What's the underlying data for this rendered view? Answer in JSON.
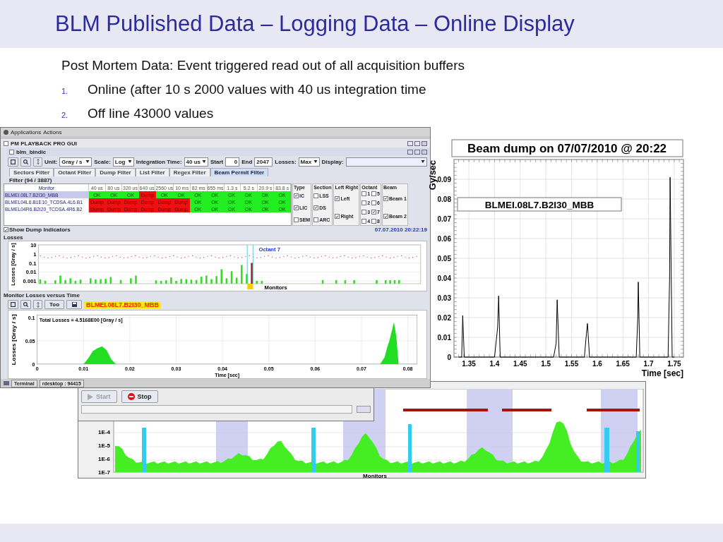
{
  "slide": {
    "title": "BLM Published Data – Logging Data – Online Display",
    "intro": "Post Mortem Data: Event triggered read out of all acquisition buffers",
    "items": [
      {
        "number": "1.",
        "text": "Online (after 10 s 2000 values with 40 us integration time"
      },
      {
        "number": "2.",
        "text": "Off line 43000 values"
      }
    ]
  },
  "gui": {
    "desktop_menu": [
      "Applications",
      "Actions"
    ],
    "window_title": "PM PLAYBACK PRO GUI",
    "frame_title": "blm_bindic",
    "toolbar": {
      "unit_label": "Unit:",
      "unit": "Gray / s",
      "scale_label": "Scale:",
      "scale": "Log",
      "integration_label": "Integration Time:",
      "integration": "40 us",
      "start_label": "Start",
      "start": "0",
      "end_label": "End",
      "end": "2047",
      "losses_label": "Losses:",
      "losses": "Max",
      "display_label": "Display:"
    },
    "tabs": [
      {
        "label": "Sectors Filter",
        "selected": false
      },
      {
        "label": "Octant Filter",
        "selected": false
      },
      {
        "label": "Dump Filter",
        "selected": false
      },
      {
        "label": "List Filter",
        "selected": false
      },
      {
        "label": "Regex Filter",
        "selected": false
      },
      {
        "label": "Beam Permit Filter",
        "selected": true
      }
    ],
    "filter_count": "Filter (94 / 3887)",
    "table": {
      "columns": [
        "Monitor",
        "40 us",
        "80 us",
        "320 us",
        "640 us",
        "2560 us",
        "10 ms",
        "82 ms",
        "655 ms",
        "1.3 s",
        "5.2 s",
        "20.9 s",
        "83.8 s"
      ],
      "rows": [
        {
          "selected": true,
          "cells": [
            {
              "kind": "monitor",
              "text": "BLMEI.08L7.B2I30_MBB"
            },
            {
              "kind": "ok",
              "text": "OK"
            },
            {
              "kind": "ok",
              "text": "OK"
            },
            {
              "kind": "ok",
              "text": "OK"
            },
            {
              "kind": "dump",
              "text": "Dump"
            },
            {
              "kind": "ok",
              "text": "OK"
            },
            {
              "kind": "ok",
              "text": "OK"
            },
            {
              "kind": "ok",
              "text": "OK"
            },
            {
              "kind": "ok",
              "text": "OK"
            },
            {
              "kind": "ok",
              "text": "OK"
            },
            {
              "kind": "ok",
              "text": "OK"
            },
            {
              "kind": "ok",
              "text": "OK"
            },
            {
              "kind": "ok",
              "text": "OK"
            }
          ]
        },
        {
          "selected": false,
          "cells": [
            {
              "kind": "monitor",
              "text": "BLMEL04L6.B1E10_TCDSA.4L6.B1"
            },
            {
              "kind": "dump",
              "text": "Dump"
            },
            {
              "kind": "dump",
              "text": "Dump"
            },
            {
              "kind": "dump",
              "text": "Dump"
            },
            {
              "kind": "dump",
              "text": "Dump"
            },
            {
              "kind": "dump",
              "text": "Dump"
            },
            {
              "kind": "dump",
              "text": "Dump"
            },
            {
              "kind": "ok",
              "text": "OK"
            },
            {
              "kind": "ok",
              "text": "OK"
            },
            {
              "kind": "ok",
              "text": "OK"
            },
            {
              "kind": "ok",
              "text": "OK"
            },
            {
              "kind": "ok",
              "text": "OK"
            },
            {
              "kind": "ok",
              "text": "OK"
            }
          ]
        },
        {
          "selected": false,
          "cells": [
            {
              "kind": "monitor",
              "text": "BLMEL04R6.B2I20_TCDSA.4R6.B2"
            },
            {
              "kind": "dump",
              "text": "Dump"
            },
            {
              "kind": "dump",
              "text": "Dump"
            },
            {
              "kind": "dump",
              "text": "Dump"
            },
            {
              "kind": "dump",
              "text": "Dump"
            },
            {
              "kind": "dump",
              "text": "Dump"
            },
            {
              "kind": "dump",
              "text": "Dump"
            },
            {
              "kind": "ok",
              "text": "OK"
            },
            {
              "kind": "ok",
              "text": "OK"
            },
            {
              "kind": "ok",
              "text": "OK"
            },
            {
              "kind": "ok",
              "text": "OK"
            },
            {
              "kind": "ok",
              "text": "OK"
            },
            {
              "kind": "ok",
              "text": "OK"
            }
          ]
        }
      ]
    },
    "filters": [
      {
        "title": "Type",
        "options": [
          {
            "label": "IC",
            "checked": true
          },
          {
            "label": "LIC",
            "checked": true
          },
          {
            "label": "SEM",
            "checked": false
          }
        ]
      },
      {
        "title": "Section",
        "options": [
          {
            "label": "LSS",
            "checked": false
          },
          {
            "label": "DS",
            "checked": true
          },
          {
            "label": "ARC",
            "checked": false
          }
        ]
      },
      {
        "title": "Left Right",
        "options": [
          {
            "label": "Left",
            "checked": true
          },
          {
            "label": "Right",
            "checked": true
          }
        ]
      },
      {
        "title": "Octant",
        "options": [
          {
            "label": "1",
            "checked": false
          },
          {
            "label": "5",
            "checked": false
          },
          {
            "label": "2",
            "checked": false
          },
          {
            "label": "6",
            "checked": false
          },
          {
            "label": "3",
            "checked": false
          },
          {
            "label": "7",
            "checked": true
          },
          {
            "label": "4",
            "checked": false
          },
          {
            "label": "8",
            "checked": false
          }
        ]
      },
      {
        "title": "Beam",
        "options": [
          {
            "label": "Beam 1",
            "checked": true
          },
          {
            "label": "Beam 2",
            "checked": true
          }
        ]
      }
    ],
    "show_dump": {
      "label": "Show Dump Indicators",
      "checked": true
    },
    "timestamp": "07.07.2010 20:22:19",
    "losses_panel": {
      "title": "Losses",
      "ylabel": "Losses [Gray / s]",
      "yticks": [
        "10",
        "1",
        "0.1",
        "0.01",
        "0.001"
      ],
      "xlabel": "Monitors",
      "marker": "Octant 7"
    },
    "time_panel": {
      "title": "Monitor Losses versus Time",
      "too_button": "Too",
      "monitor": "BLMEI.08L7.B2I30_MBB",
      "chart_data": {
        "type": "area",
        "grid": true,
        "ylabel": "Losses [Gray / s]",
        "xlabel": "Time [sec]",
        "annotations": [
          "Total Losses = 4.5168E00 [Gray / s]"
        ],
        "xlim": [
          0,
          0.082
        ],
        "ylim": [
          0,
          0.105
        ],
        "xticks": [
          {
            "value": 0,
            "label": "0"
          },
          {
            "value": 0.01,
            "label": "0.01"
          },
          {
            "value": 0.02,
            "label": "0.02"
          },
          {
            "value": 0.03,
            "label": "0.03"
          },
          {
            "value": 0.04,
            "label": "0.04"
          },
          {
            "value": 0.05,
            "label": "0.05"
          },
          {
            "value": 0.06,
            "label": "0.06"
          },
          {
            "value": 0.07,
            "label": "0.07"
          },
          {
            "value": 0.08,
            "label": "0.08"
          }
        ],
        "yticks": [
          {
            "value": 0,
            "label": "0"
          },
          {
            "value": 0.05,
            "label": "0.05"
          },
          {
            "value": 0.1,
            "label": "0.1"
          }
        ],
        "x": [
          0,
          0.01,
          0.011,
          0.012,
          0.013,
          0.014,
          0.015,
          0.016,
          0.017,
          0.074,
          0.075,
          0.0755,
          0.076,
          0.0765,
          0.077,
          0.0775,
          0.078,
          0.082
        ],
        "series": [
          {
            "color": "#22dd22",
            "values": [
              0,
              0,
              0.012,
              0.028,
              0.034,
              0.038,
              0.03,
              0.01,
              0,
              0,
              0.015,
              0.035,
              0.05,
              0.07,
              0.09,
              0.06,
              0,
              0
            ]
          }
        ]
      }
    },
    "taskbar": [
      "Terminal",
      "rdesktop : 94415"
    ]
  },
  "logging": {
    "start": "Start",
    "start_disabled": true,
    "stop": "Stop",
    "yticks": [
      "1E-4",
      "1E-5",
      "1E-6",
      "1E-7"
    ],
    "xlabel": "Monitors"
  },
  "beam_dump": {
    "chart_data": {
      "type": "line",
      "grid": true,
      "title": "Beam dump on 07/07/2010 @ 20:22",
      "xlabel": "Time [sec]",
      "ylabel": "Gy/sec",
      "annotations": [
        "BLMEI.08L7.B2I30_MBB"
      ],
      "xlim": [
        1.321,
        1.768
      ],
      "ylim": [
        0,
        0.1
      ],
      "xticks": [
        {
          "value": 1.35,
          "label": "1.35"
        },
        {
          "value": 1.4,
          "label": "1.4"
        },
        {
          "value": 1.45,
          "label": "1.45"
        },
        {
          "value": 1.5,
          "label": "1.5"
        },
        {
          "value": 1.55,
          "label": "1.55"
        },
        {
          "value": 1.6,
          "label": "1.6"
        },
        {
          "value": 1.65,
          "label": "1.65"
        },
        {
          "value": 1.7,
          "label": "1.7"
        },
        {
          "value": 1.75,
          "label": "1.75"
        }
      ],
      "yticks": [
        {
          "value": 0,
          "label": "0"
        },
        {
          "value": 0.01,
          "label": "0.01"
        },
        {
          "value": 0.02,
          "label": "0.02"
        },
        {
          "value": 0.03,
          "label": "0.03"
        },
        {
          "value": 0.04,
          "label": "0.04"
        },
        {
          "value": 0.05,
          "label": "0.05"
        },
        {
          "value": 0.06,
          "label": "0.06"
        },
        {
          "value": 0.07,
          "label": "0.07"
        },
        {
          "value": 0.08,
          "label": "0.08"
        },
        {
          "value": 0.09,
          "label": "0.09"
        }
      ],
      "x": [
        1.33,
        1.336,
        1.338,
        1.341,
        1.4,
        1.406,
        1.408,
        1.411,
        1.515,
        1.52,
        1.522,
        1.526,
        1.575,
        1.579,
        1.581,
        1.585,
        1.676,
        1.679,
        1.68,
        1.683,
        1.738,
        1.741,
        1.742,
        1.746,
        1.75
      ],
      "series": [
        {
          "color": "#000000",
          "values": [
            0,
            0,
            0.021,
            0,
            0,
            0.015,
            0.031,
            0,
            0,
            0.007,
            0.029,
            0,
            0,
            0.012,
            0.017,
            0,
            0,
            0.02,
            0.038,
            0,
            0,
            0.04,
            0.091,
            0,
            0
          ]
        }
      ]
    }
  }
}
